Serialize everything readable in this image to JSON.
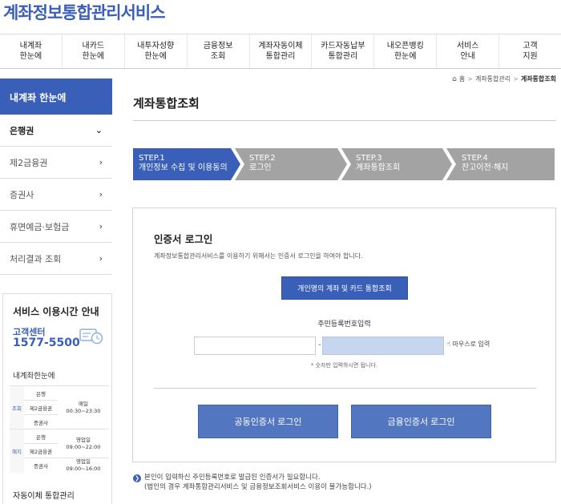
{
  "site": {
    "title": "계좌정보통합관리서비스"
  },
  "gnb": [
    "내계좌\n한눈에",
    "내카드\n한눈에",
    "내투자성향\n한눈에",
    "금융정보\n조회",
    "계좌자동이체\n통합관리",
    "카드자동납부\n통합관리",
    "내오픈뱅킹\n한눈에",
    "서비스\n안내",
    "고객\n지원"
  ],
  "breadcrumb": {
    "home": "홈",
    "parent": "계좌통합관리",
    "current": "계좌통합조회"
  },
  "sidebar": {
    "head": "내계좌 한눈에",
    "items": [
      {
        "label": "은행권",
        "chev": "⌄"
      },
      {
        "label": "제2금융권",
        "chev": "›"
      },
      {
        "label": "증권사",
        "chev": "›"
      },
      {
        "label": "휴면예금·보험금",
        "chev": "›"
      },
      {
        "label": "처리결과 조회",
        "chev": "›"
      }
    ]
  },
  "service": {
    "title": "서비스 이용시간 안내",
    "cs_label": "고객센터",
    "cs_number": "1577-5500",
    "hours_title": "내계좌한눈에",
    "lookup_label": "조회",
    "cancel_label": "해지",
    "rows": {
      "bank": "은행",
      "second": "제2금융권",
      "securities": "증권사",
      "daily": "매일",
      "daily_time": "00:30~23:30",
      "biz": "영업일",
      "biz_time_1": "09:00~22:00",
      "biz_time_2": "09:00~16:00"
    },
    "auto_title": "자동이체 통합관리"
  },
  "main": {
    "title": "계좌통합조회",
    "steps": [
      {
        "num": "STEP.1",
        "label": "개인정보 수집 및 이용동의"
      },
      {
        "num": "STEP.2",
        "label": "로그인"
      },
      {
        "num": "STEP.3",
        "label": "계좌통합조회"
      },
      {
        "num": "STEP.4",
        "label": "잔고이전·해지"
      }
    ],
    "login": {
      "title": "인증서 로그인",
      "desc": "계좌정보통합관리서비스를 이용하기 위해서는 인증서 로그인을 하여야 합니다.",
      "personal_button": "개인명의 계좌 및 카드 통합조회",
      "rrn_label": "주민등록번호입력",
      "rrn_dash": "-",
      "mouse_input": "마우스로 입력",
      "hint": "* 숫자만 입력하시면 됩니다.",
      "public_cert_button": "공동인증서 로그인",
      "financial_cert_button": "금융인증서 로그인"
    },
    "notice": {
      "line1": "본인이 입력하신 주민등록번호로 발급된 인증서가 필요합니다.",
      "line2": "(법인의 경우 계좌통합관리서비스 및 금융정보조회서비스 이용이 불가능합니다.)"
    }
  },
  "colors": {
    "brand": "#3a5fb8",
    "step_active": "#3a5fb8",
    "step_inactive": "#a3a3a3",
    "input_highlight": "#c6d6ef"
  },
  "icons": {
    "home": "home-icon",
    "mouse": "mouse-icon",
    "notice": "info-icon",
    "cs": "phone-clock-icon"
  }
}
